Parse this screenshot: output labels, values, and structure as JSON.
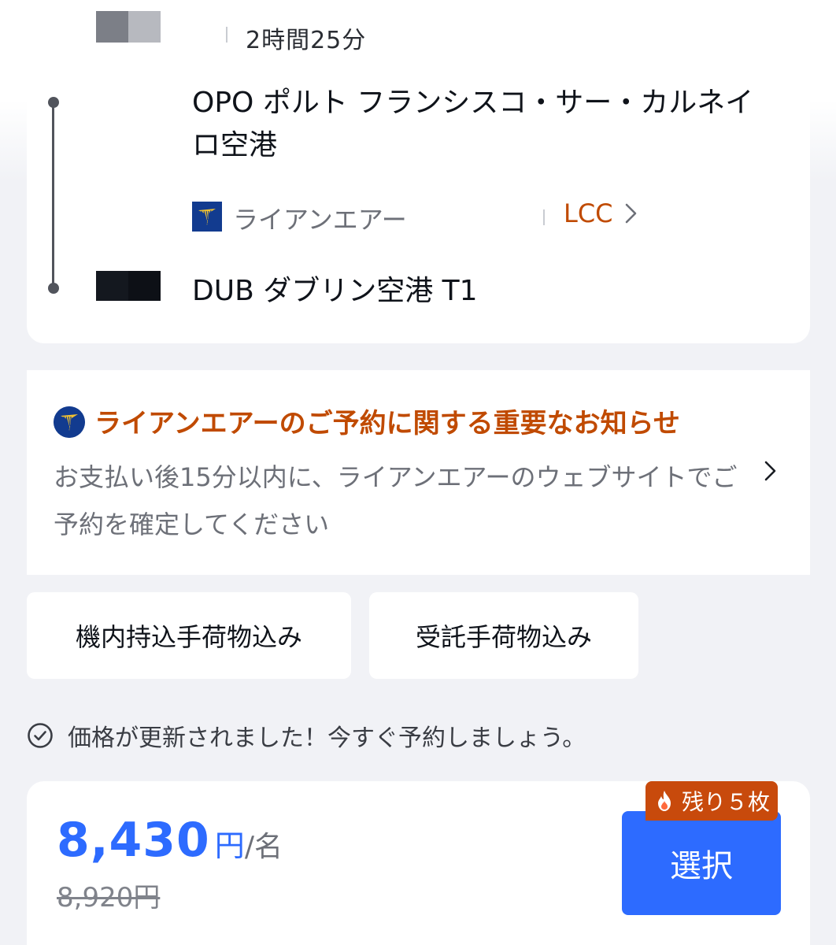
{
  "flight": {
    "duration": "2時間25分",
    "origin": "OPO ポルト フランシスコ・サー・カルネイロ空港",
    "airline": "ライアンエアー",
    "carrier_type": "LCC",
    "destination": "DUB ダブリン空港 T1"
  },
  "notice": {
    "title": "ライアンエアーのご予約に関する重要なお知らせ",
    "body": "お支払い後15分以内に、ライアンエアーのウェブサイトでご予約を確定してください"
  },
  "baggage": {
    "carry_on": "機内持込手荷物込み",
    "checked": "受託手荷物込み"
  },
  "price_updated": "価格が更新されました！今すぐ予約しましょう。",
  "pricing": {
    "amount": "8,430",
    "currency": "円",
    "per": "/名",
    "original": "8,920円",
    "select_label": "選択",
    "remaining": "残り５枚"
  },
  "colors": {
    "accent": "#2d6bff",
    "alert": "#c04a00",
    "badge": "#c84a0c",
    "airline_brand": "#123b8f"
  },
  "icons": {
    "airline_logo": "harp-logo-icon",
    "chevron": "chevron-right-icon",
    "check": "check-circle-icon",
    "flame": "flame-icon"
  }
}
